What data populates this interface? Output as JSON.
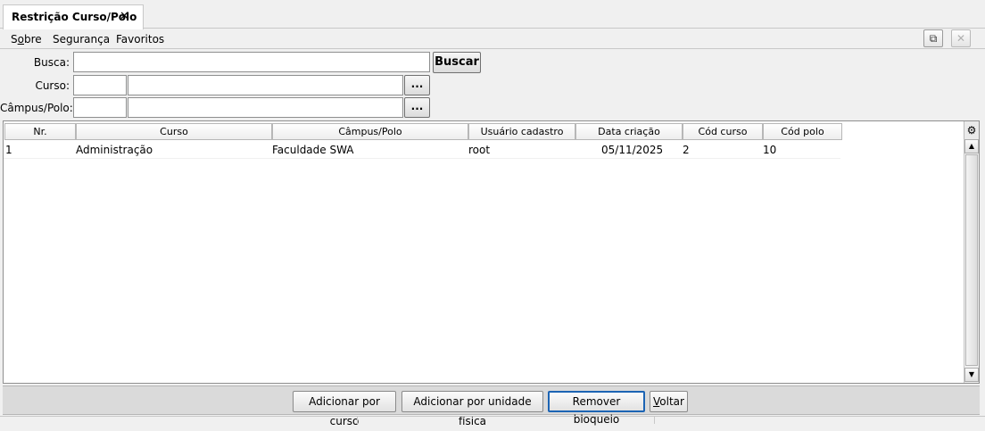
{
  "tab": {
    "title": "Restrição Curso/Polo",
    "close_glyph": "✕"
  },
  "menu": {
    "sobre_prefix": "S",
    "sobre_underlined": "o",
    "sobre_rest": "bre",
    "seguranca": "Segurança",
    "favoritos": "Favoritos"
  },
  "window": {
    "detach_glyph": "⧉",
    "close_glyph": "✕"
  },
  "form": {
    "busca_label": "Busca:",
    "busca_value": "",
    "buscar_label": "Buscar",
    "curso_label": "Curso:",
    "curso_code": "",
    "curso_name": "",
    "campus_label": "Câmpus/Polo:",
    "campus_code": "",
    "campus_name": "",
    "lookup_label": "..."
  },
  "table": {
    "columns": [
      "Nr.",
      "Curso",
      "Câmpus/Polo",
      "Usuário cadastro",
      "Data criação",
      "Cód curso",
      "Cód polo"
    ],
    "rows": [
      {
        "nr": "1",
        "curso": "Administração",
        "campus": "Faculdade SWA",
        "usuario": "root",
        "data": "05/11/2025",
        "cod_curso": "2",
        "cod_polo": "10"
      }
    ],
    "gear_glyph": "⚙",
    "scroll_up": "▲",
    "scroll_down": "▼"
  },
  "footer": {
    "add_course": "Adicionar por curso",
    "add_unit": "Adicionar por unidade física",
    "remove_block": "Remover bloqueio",
    "back_underlined": "V",
    "back_rest": "oltar"
  }
}
